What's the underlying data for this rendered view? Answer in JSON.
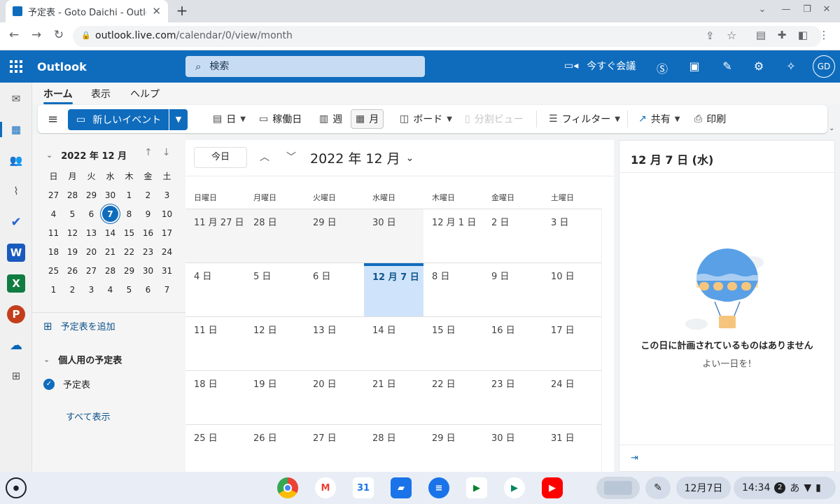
{
  "browser": {
    "tab_title": "予定表 - Goto Daichi - Outlook",
    "new_tab": "+",
    "url_host": "outlook.live.com",
    "url_path": "/calendar/0/view/month"
  },
  "header": {
    "brand": "Outlook",
    "search_placeholder": "検索",
    "meet_now": "今すぐ会議",
    "avatar_initials": "GD"
  },
  "ribbon_tabs": [
    "ホーム",
    "表示",
    "ヘルプ"
  ],
  "ribbon": {
    "new_event": "新しいイベント",
    "day": "日",
    "work_week": "稼働日",
    "week": "週",
    "month": "月",
    "board": "ボード",
    "split_view": "分割ビュー",
    "filter": "フィルター",
    "share": "共有",
    "print": "印刷"
  },
  "mini_calendar": {
    "title": "2022 年 12 月",
    "weekdays": [
      "日",
      "月",
      "火",
      "水",
      "木",
      "金",
      "土"
    ],
    "days": [
      "27",
      "28",
      "29",
      "30",
      "1",
      "2",
      "3",
      "4",
      "5",
      "6",
      "7",
      "8",
      "9",
      "10",
      "11",
      "12",
      "13",
      "14",
      "15",
      "16",
      "17",
      "18",
      "19",
      "20",
      "21",
      "22",
      "23",
      "24",
      "25",
      "26",
      "27",
      "28",
      "29",
      "30",
      "31",
      "1",
      "2",
      "3",
      "4",
      "5",
      "6",
      "7"
    ],
    "today_index": 10
  },
  "left_pane": {
    "add_calendar": "予定表を追加",
    "group_title": "個人用の予定表",
    "calendar_name": "予定表",
    "show_all": "すべて表示"
  },
  "calendar": {
    "today_button": "今日",
    "title": "2022 年 12 月",
    "weekday_headers": [
      "日曜日",
      "月曜日",
      "火曜日",
      "水曜日",
      "木曜日",
      "金曜日",
      "土曜日"
    ],
    "weeks": [
      [
        "11 月 27 日",
        "28 日",
        "29 日",
        "30 日",
        "12 月 1 日",
        "2 日",
        "3 日"
      ],
      [
        "4 日",
        "5 日",
        "6 日",
        "12 月 7 日",
        "8 日",
        "9 日",
        "10 日"
      ],
      [
        "11 日",
        "12 日",
        "13 日",
        "14 日",
        "15 日",
        "16 日",
        "17 日"
      ],
      [
        "18 日",
        "19 日",
        "20 日",
        "21 日",
        "22 日",
        "23 日",
        "24 日"
      ],
      [
        "25 日",
        "26 日",
        "27 日",
        "28 日",
        "29 日",
        "30 日",
        "31 日"
      ]
    ],
    "selected": [
      1,
      3
    ],
    "other_month_week0": [
      0,
      1,
      2,
      3
    ]
  },
  "day_pane": {
    "title": "12 月 7 日 (水)",
    "empty_title": "この日に計画されているものはありません",
    "empty_subtitle": "よい一日を!"
  },
  "shelf": {
    "calendar_app_day": "31",
    "date": "12月7日",
    "time": "14:34",
    "notification_count": "2",
    "ime": "あ"
  },
  "colors": {
    "accent": "#0f6cbd",
    "selected_day": "#cfe4fa"
  }
}
